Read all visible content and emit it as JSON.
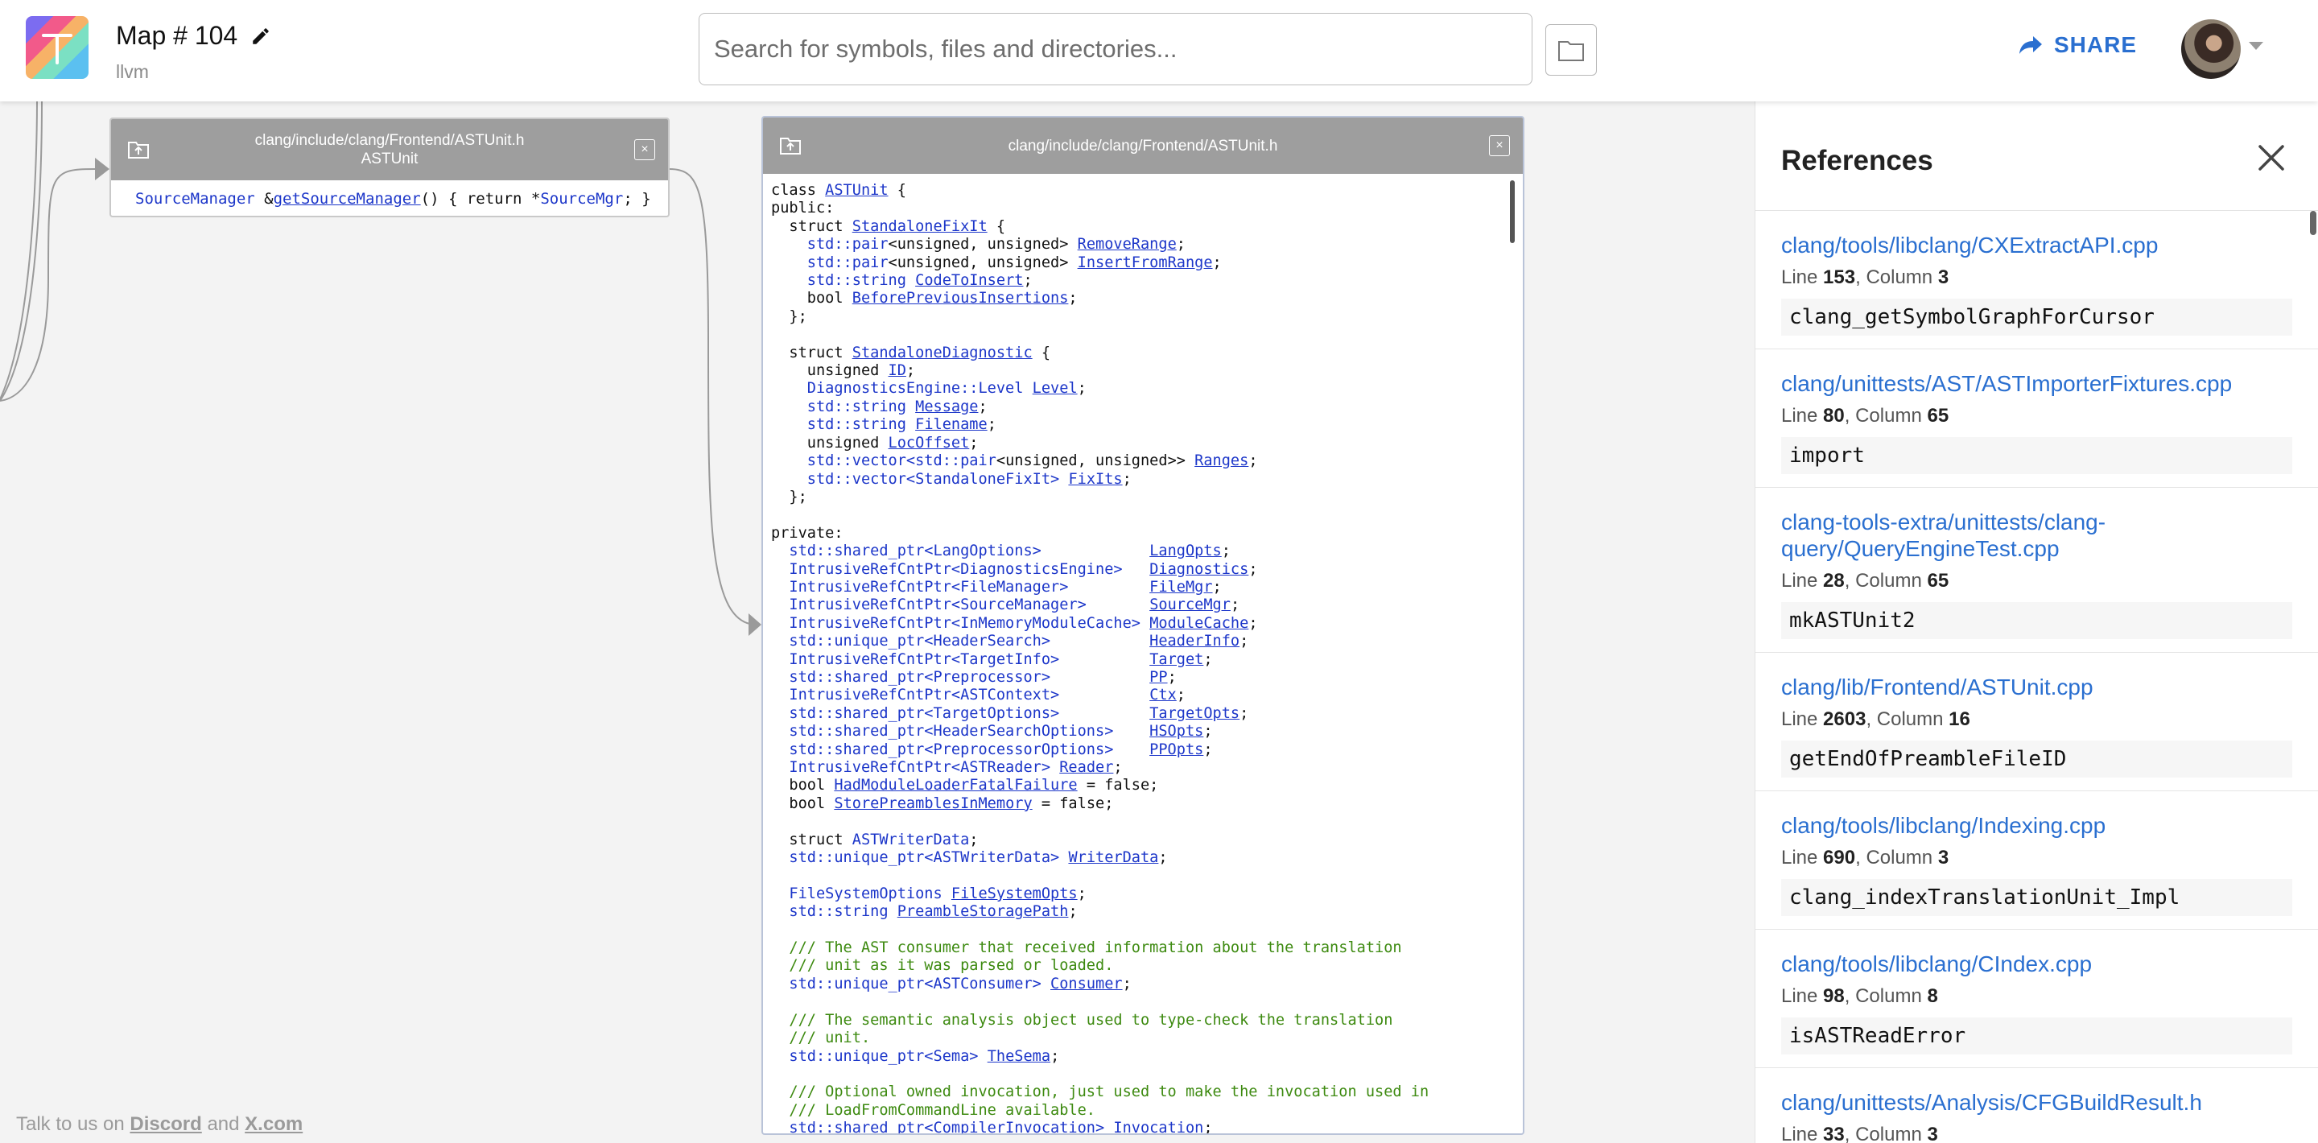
{
  "header": {
    "map_title": "Map # 104",
    "map_sub": "llvm",
    "search_placeholder": "Search for symbols, files and directories...",
    "share_label": "SHARE"
  },
  "card_small": {
    "path": "clang/include/clang/Frontend/ASTUnit.h",
    "symbol": "ASTUnit",
    "close": "×",
    "code": {
      "type": "SourceManager",
      "amp": " &",
      "method": "getSourceManager",
      "body": "() { return *",
      "member": "SourceMgr",
      "end": "; }"
    }
  },
  "card_big": {
    "path": "clang/include/clang/Frontend/ASTUnit.h",
    "close": "×"
  },
  "footer": {
    "prefix": "Talk to us on ",
    "discord": "Discord",
    "and": " and ",
    "xcom": "X.com"
  },
  "references": {
    "title": "References",
    "line_label": "Line",
    "column_label": "Column",
    "items": [
      {
        "path": "clang/tools/libclang/CXExtractAPI.cpp",
        "line": "153",
        "column": "3",
        "code": "clang_getSymbolGraphForCursor"
      },
      {
        "path": "clang/unittests/AST/ASTImporterFixtures.cpp",
        "line": "80",
        "column": "65",
        "code": "import"
      },
      {
        "path": "clang-tools-extra/unittests/clang-query/QueryEngineTest.cpp",
        "line": "28",
        "column": "65",
        "code": "mkASTUnit2"
      },
      {
        "path": "clang/lib/Frontend/ASTUnit.cpp",
        "line": "2603",
        "column": "16",
        "code": "getEndOfPreambleFileID"
      },
      {
        "path": "clang/tools/libclang/Indexing.cpp",
        "line": "690",
        "column": "3",
        "code": "clang_indexTranslationUnit_Impl"
      },
      {
        "path": "clang/tools/libclang/CIndex.cpp",
        "line": "98",
        "column": "8",
        "code": "isASTReadError"
      },
      {
        "path": "clang/unittests/Analysis/CFGBuildResult.h",
        "line": "33",
        "column": "3",
        "code": ""
      }
    ]
  }
}
